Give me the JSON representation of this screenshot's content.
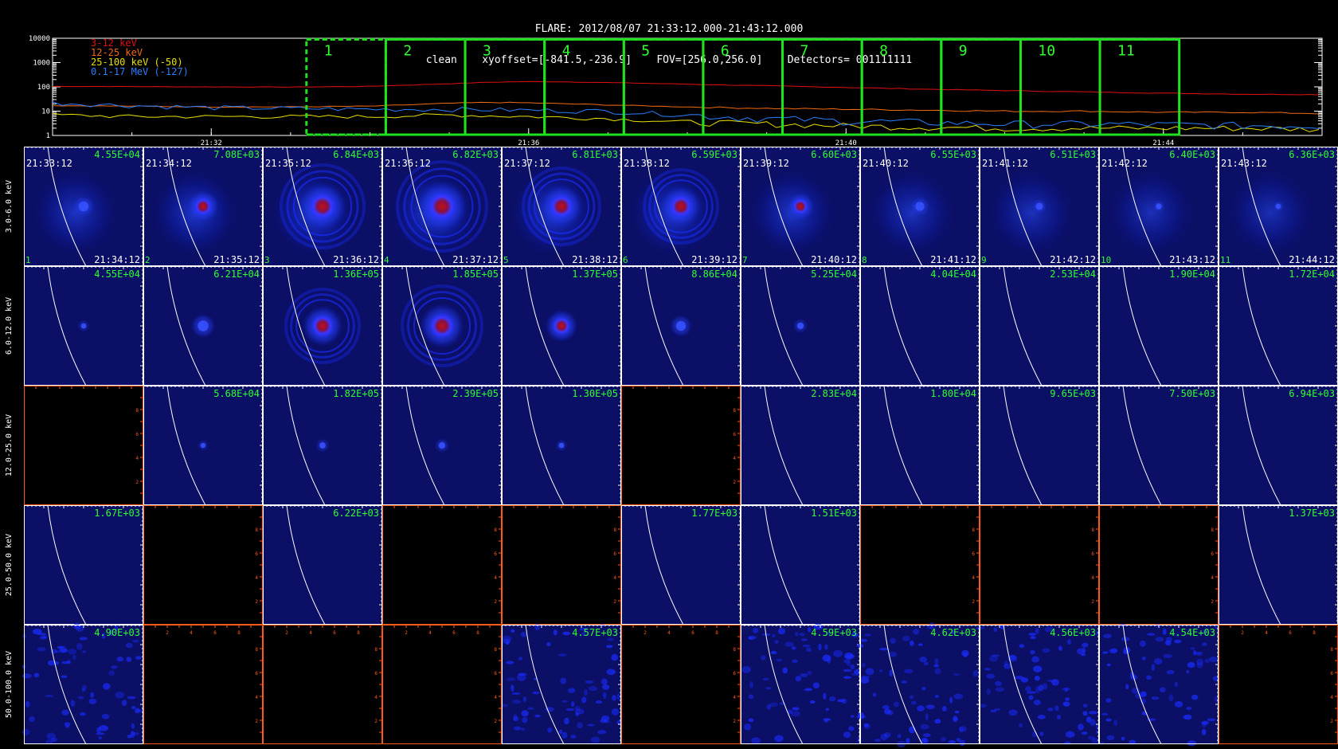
{
  "header": {
    "title_line1": "FLARE: 2012/08/07 21:33:12.000-21:43:12.000",
    "title_line2": "clean    xyoffset=[-841.5,-236.9]    FOV=[256.0,256.0]    Detectors= 001111111"
  },
  "colors": {
    "band_3_12": "#e01010",
    "band_12_25": "#f06a10",
    "band_25_100": "#e8e000",
    "band_0_1_17": "#2a7fff",
    "interval_box": "#20e020",
    "label_green": "#30ff30",
    "empty_axis": "#ff5a1a"
  },
  "chart_data": [
    {
      "type": "line",
      "yscale": "log",
      "ylim": [
        1,
        10000
      ],
      "xlim": [
        "21:30:00",
        "21:46:00"
      ],
      "yticks": [
        "1",
        "10",
        "100",
        "1000",
        "10000"
      ],
      "xticks": [
        "21:32",
        "21:36",
        "21:40",
        "21:44"
      ],
      "series": [
        {
          "name": "3-12 keV",
          "color": "#e01010",
          "x": [
            0,
            1,
            2,
            3,
            4,
            5,
            5.5,
            6,
            6.5,
            7,
            8,
            9,
            10,
            11,
            12,
            13,
            14,
            15,
            16
          ],
          "values": [
            105,
            103,
            100,
            98,
            105,
            135,
            155,
            165,
            160,
            150,
            130,
            110,
            95,
            80,
            70,
            62,
            55,
            50,
            48
          ]
        },
        {
          "name": "12-25 keV",
          "color": "#f06a10",
          "x": [
            0,
            1,
            2,
            3,
            4,
            5,
            5.5,
            6,
            6.5,
            7,
            8,
            9,
            10,
            11,
            12,
            13,
            14,
            15,
            16
          ],
          "values": [
            17,
            16,
            15,
            15,
            16,
            21,
            23,
            22,
            20,
            18,
            15,
            13,
            12,
            11,
            10,
            10,
            9,
            9,
            8
          ]
        },
        {
          "name": "25-100 keV (-50)",
          "color": "#e8e000",
          "x": [
            0,
            1,
            2,
            3,
            4,
            5,
            6,
            7,
            8,
            9,
            10,
            11,
            12,
            13,
            14,
            15,
            16
          ],
          "values": [
            7,
            6,
            6,
            6,
            6,
            7,
            6,
            5,
            3.5,
            3,
            2.5,
            2.2,
            2,
            2,
            2,
            2,
            1.8
          ]
        },
        {
          "name": "0.1-17 MeV (-127)",
          "color": "#2a7fff",
          "x": [
            0,
            1,
            2,
            3,
            4,
            5,
            6,
            7,
            8,
            9,
            10,
            11,
            12,
            13,
            14,
            15,
            16
          ],
          "values": [
            22,
            17,
            14,
            13,
            12,
            12,
            11,
            10,
            7,
            5,
            4,
            3.5,
            3,
            3,
            2.8,
            2.6,
            2.5
          ]
        }
      ],
      "intervals": [
        "1",
        "2",
        "3",
        "4",
        "5",
        "6",
        "7",
        "8",
        "9",
        "10",
        "11"
      ]
    },
    {
      "type": "heatmap",
      "energy_bands": [
        "3.0-6.0 keV",
        "6.0-12.0 keV",
        "12.0-25.0 keV",
        "25.0-50.0 keV",
        "50.0-100.0 keV"
      ],
      "start_times": [
        "21:33:12",
        "21:34:12",
        "21:35:12",
        "21:36:12",
        "21:37:12",
        "21:38:12",
        "21:39:12",
        "21:40:12",
        "21:41:12",
        "21:42:12",
        "21:43:12"
      ],
      "end_times": [
        "21:34:12",
        "21:35:12",
        "21:36:12",
        "21:37:12",
        "21:38:12",
        "21:39:12",
        "21:40:12",
        "21:41:12",
        "21:42:12",
        "21:43:12",
        "21:44:12"
      ],
      "max_values": [
        [
          "4.55E+04",
          "7.08E+03",
          "6.84E+03",
          "6.82E+03",
          "6.81E+03",
          "6.59E+03",
          "6.60E+03",
          "6.55E+03",
          "6.51E+03",
          "6.40E+03",
          "6.36E+03"
        ],
        [
          "4.55E+04",
          "6.21E+04",
          "1.36E+05",
          "1.85E+05",
          "1.37E+05",
          "8.86E+04",
          "5.25E+04",
          "4.04E+04",
          "2.53E+04",
          "1.90E+04",
          "1.72E+04"
        ],
        [
          null,
          "5.68E+04",
          "1.82E+05",
          "2.39E+05",
          "1.30E+05",
          null,
          "2.83E+04",
          "1.80E+04",
          "9.65E+03",
          "7.50E+03",
          "6.94E+03"
        ],
        [
          "1.67E+03",
          null,
          "6.22E+03",
          null,
          null,
          "1.77E+03",
          "1.51E+03",
          null,
          null,
          null,
          "1.37E+03"
        ],
        [
          "4.90E+03",
          null,
          null,
          null,
          "4.57E+03",
          null,
          "4.59E+03",
          "4.62E+03",
          "4.56E+03",
          "4.54E+03",
          null
        ]
      ],
      "source_strength": [
        [
          0.3,
          0.55,
          0.9,
          1.0,
          0.8,
          0.75,
          0.45,
          0.25,
          0.15,
          0.08,
          0.05
        ],
        [
          0.05,
          0.35,
          0.75,
          0.85,
          0.55,
          0.3,
          0.12,
          0,
          0,
          0,
          0
        ],
        [
          0,
          0.03,
          0.1,
          0.12,
          0.05,
          0,
          0,
          0,
          0,
          0,
          0
        ],
        [
          0,
          0,
          0,
          0,
          0,
          0,
          0,
          0,
          0,
          0,
          0
        ],
        [
          0,
          0,
          0,
          0,
          0,
          0,
          0,
          0,
          0,
          0,
          0
        ]
      ],
      "empty_axis_ticks": [
        "2",
        "4",
        "6",
        "8"
      ]
    }
  ]
}
